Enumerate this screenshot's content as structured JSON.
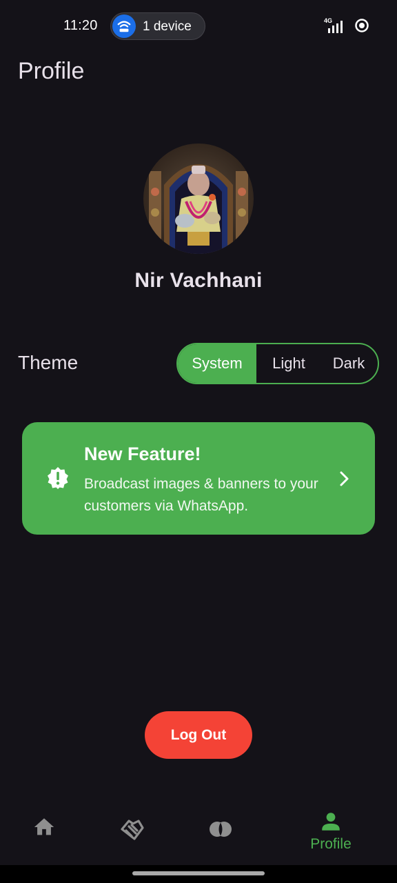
{
  "status_bar": {
    "time": "11:20",
    "device_chip": "1 device",
    "network": "4G"
  },
  "header": {
    "title": "Profile"
  },
  "profile": {
    "name": "Nir Vachhani"
  },
  "theme": {
    "label": "Theme",
    "options": [
      "System",
      "Light",
      "Dark"
    ],
    "selected": "System"
  },
  "feature_card": {
    "title": "New Feature!",
    "description": "Broadcast images & banners to your customers via WhatsApp."
  },
  "actions": {
    "logout_label": "Log Out"
  },
  "bottom_nav": {
    "items": [
      {
        "icon": "home-icon",
        "label": ""
      },
      {
        "icon": "handshake-icon",
        "label": ""
      },
      {
        "icon": "coins-icon",
        "label": ""
      },
      {
        "icon": "person-icon",
        "label": "Profile"
      }
    ],
    "active": "Profile"
  },
  "colors": {
    "background": "#141218",
    "accent": "#4caf50",
    "danger": "#f44336",
    "inactive_icon": "#8f8f8f"
  }
}
